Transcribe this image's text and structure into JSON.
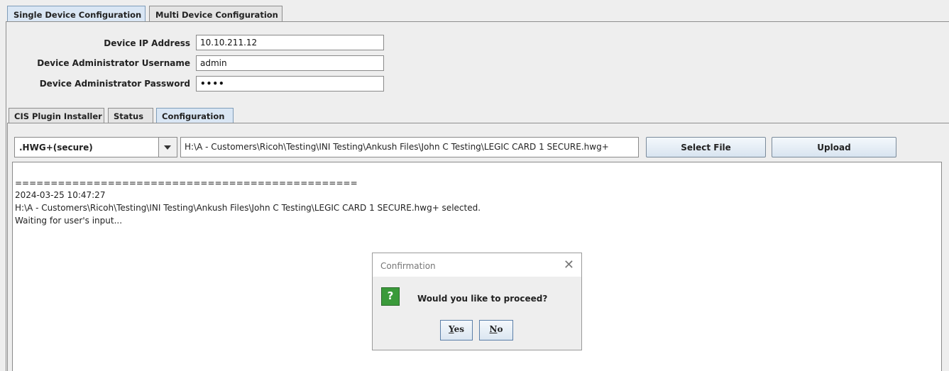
{
  "top_tabs": {
    "single": "Single Device Configuration",
    "multi": "Multi Device Configuration"
  },
  "fields": {
    "ip_label": "Device IP Address",
    "ip_value": "10.10.211.12",
    "user_label": "Device Administrator Username",
    "user_value": "admin",
    "pass_label": "Device Administrator Password",
    "pass_value": "••••"
  },
  "inner_tabs": {
    "installer": "CIS Plugin Installer",
    "status": "Status",
    "configuration": "Configuration"
  },
  "format_combo": {
    "selected": ".HWG+(secure)"
  },
  "file_path": "H:\\A - Customers\\Ricoh\\Testing\\INI Testing\\Ankush Files\\John C Testing\\LEGIC CARD 1 SECURE.hwg+",
  "buttons": {
    "select_file": "Select File",
    "upload": "Upload"
  },
  "log": {
    "separator": "================================================",
    "timestamp": "2024-03-25 10:47:27",
    "selected_line": "H:\\A - Customers\\Ricoh\\Testing\\INI Testing\\Ankush Files\\John C Testing\\LEGIC CARD 1 SECURE.hwg+ selected.",
    "waiting": "Waiting for user's input..."
  },
  "dialog": {
    "title": "Confirmation",
    "close": "✕",
    "icon": "?",
    "message": "Would you like to proceed?",
    "yes_first": "Y",
    "yes_rest": "es",
    "no_first": "N",
    "no_rest": "o"
  }
}
